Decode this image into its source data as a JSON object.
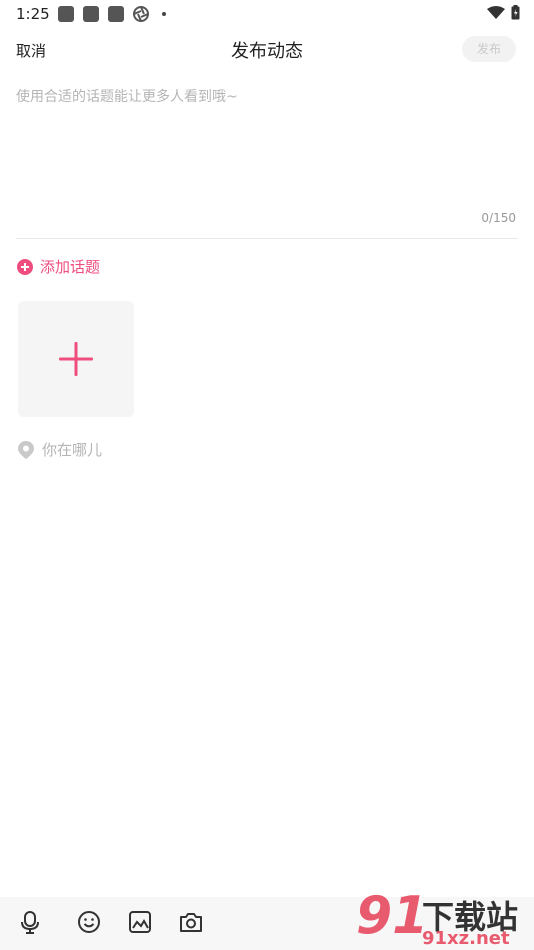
{
  "status_bar": {
    "time": "1:25"
  },
  "header": {
    "cancel_label": "取消",
    "title": "发布动态",
    "publish_label": "发布"
  },
  "editor": {
    "placeholder": "使用合适的话题能让更多人看到哦~",
    "counter": "0/150"
  },
  "topic": {
    "add_label": "添加话题"
  },
  "location": {
    "placeholder": "你在哪儿"
  },
  "watermark": {
    "number": "91",
    "text_cn": "下载站",
    "domain": "91xz.net"
  },
  "colors": {
    "accent": "#f04d7f",
    "placeholder": "#b5b5b5",
    "text": "#222222"
  }
}
